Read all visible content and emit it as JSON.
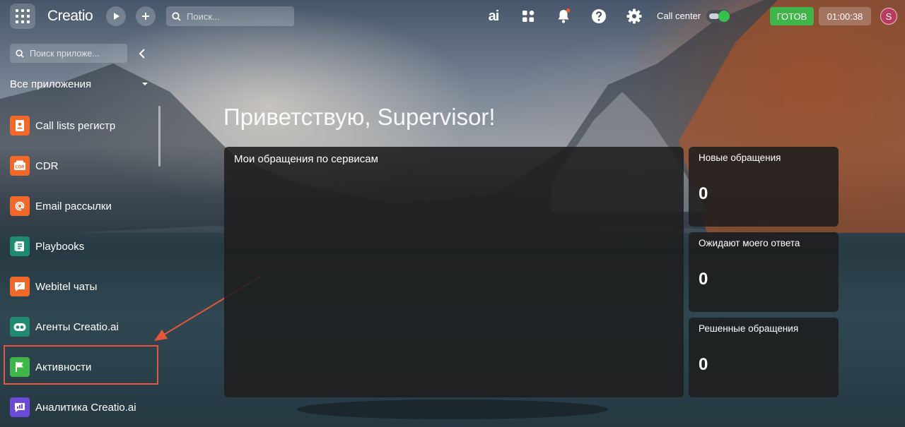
{
  "header": {
    "logo": "Creatio",
    "search_placeholder": "Поиск...",
    "ai_label": "ai",
    "call_center_label": "Call center",
    "call_center_enabled": true,
    "status_label": "ГОТОВ",
    "timer": "01:00:38",
    "avatar_letter": "S",
    "notification_dot": true
  },
  "sidebar": {
    "search_placeholder": "Поиск приложе...",
    "all_apps_label": "Все приложения",
    "items": [
      {
        "label": "Call lists регистр",
        "icon": "contact-card-icon",
        "color": "#f0692a"
      },
      {
        "label": "CDR",
        "icon": "cdr-icon",
        "color": "#f0692a"
      },
      {
        "label": "Email рассылки",
        "icon": "at-sign-icon",
        "color": "#f0692a"
      },
      {
        "label": "Playbooks",
        "icon": "playbook-icon",
        "color": "#1f8a70"
      },
      {
        "label": "Webitel чаты",
        "icon": "chat-send-icon",
        "color": "#f0692a"
      },
      {
        "label": "Агенты Creatio.ai",
        "icon": "robot-face-icon",
        "color": "#1f8a70"
      },
      {
        "label": "Активности",
        "icon": "flag-icon",
        "color": "#3fb54a"
      },
      {
        "label": "Аналитика Creatio.ai",
        "icon": "analytics-chat-icon",
        "color": "#6b4bd6"
      }
    ],
    "highlighted_item": "Активности"
  },
  "main": {
    "greeting": "Приветствую, Supervisor!",
    "main_card_title": "Мои обращения по сервисам",
    "stats": [
      {
        "title": "Новые обращения",
        "value": "0"
      },
      {
        "title": "Ожидают моего ответа",
        "value": "0"
      },
      {
        "title": "Решенные обращения",
        "value": "0"
      }
    ]
  },
  "colors": {
    "accent_green": "#3fb54a",
    "annotation_red": "#e8553a",
    "card_bg": "#1e1e1e"
  }
}
